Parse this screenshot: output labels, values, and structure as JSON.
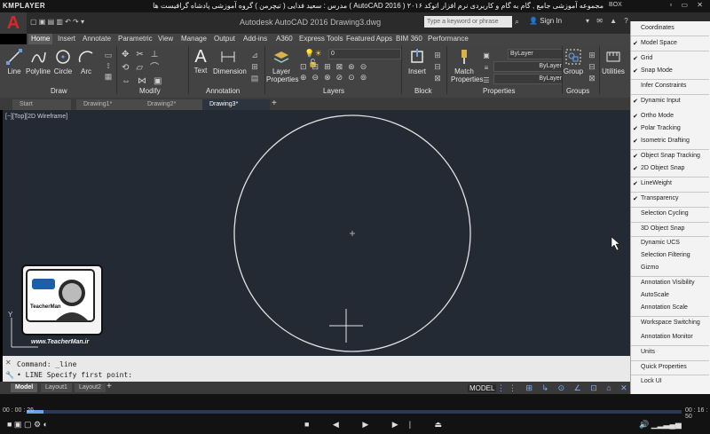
{
  "player": {
    "logo": "KMPLAYER",
    "title": "مجموعه آموزشی جامع , گام به گام و کاربردی نرم افزار اتوکد ۲۰۱۶ ( 2016 AutoCAD )  مدرس : سعید فدایی ( تیچرمن ) گروه آموزشی پادشاه گرافیست ها",
    "box_label": "BOX",
    "time_current": "00 : 00 : 26",
    "time_total": "00 : 16 : 50",
    "progress": 0.026
  },
  "acad": {
    "logo_letter": "A",
    "title": "Autodesk AutoCAD 2016   Drawing3.dwg",
    "search_placeholder": "Type a keyword or phrase",
    "sign_in": "Sign In",
    "tabs": [
      "Home",
      "Insert",
      "Annotate",
      "Parametric",
      "View",
      "Manage",
      "Output",
      "Add-ins",
      "A360",
      "Express Tools",
      "Featured Apps",
      "BIM 360",
      "Performance"
    ],
    "panels": {
      "draw": "Draw",
      "modify": "Modify",
      "annotation": "Annotation",
      "layers": "Layers",
      "block": "Block",
      "properties": "Properties",
      "groups": "Groups"
    },
    "tools": {
      "line": "Line",
      "polyline": "Polyline",
      "circle": "Circle",
      "arc": "Arc",
      "text": "Text",
      "dimension": "Dimension",
      "layer_properties_1": "Layer",
      "layer_properties_2": "Properties",
      "insert": "Insert",
      "match_properties_1": "Match",
      "match_properties_2": "Properties",
      "group": "Group",
      "utilities": "Utilities",
      "layer_value": "0",
      "bylayer_1": "ByLayer",
      "bylayer_2": "ByLayer",
      "bylayer_3": "ByLayer"
    },
    "file_tabs": [
      "Start",
      "Drawing1*",
      "Drawing2*",
      "Drawing3*"
    ],
    "view_label": "[−][Top][2D Wireframe]",
    "command_history": "Command: _line",
    "command_prompt": "• LINE Specify first point:",
    "layout_tabs": [
      "Model",
      "Layout1",
      "Layout2"
    ],
    "model_button": "MODEL",
    "watermark_site": "www.TeacherMan.ir",
    "watermark_label": "TeacherMan"
  },
  "menu": {
    "items": [
      {
        "label": "Coordinates",
        "checked": false
      },
      {
        "label": "Model Space",
        "checked": true
      },
      {
        "label": "Grid",
        "checked": true
      },
      {
        "label": "Snap Mode",
        "checked": true
      },
      {
        "label": "Infer Constraints",
        "checked": false
      },
      {
        "label": "Dynamic Input",
        "checked": true
      },
      {
        "label": "Ortho Mode",
        "checked": true
      },
      {
        "label": "Polar Tracking",
        "checked": true
      },
      {
        "label": "Isometric Drafting",
        "checked": true
      },
      {
        "label": "Object Snap Tracking",
        "checked": true
      },
      {
        "label": "2D Object Snap",
        "checked": true
      },
      {
        "label": "LineWeight",
        "checked": true
      },
      {
        "label": "Transparency",
        "checked": true
      },
      {
        "label": "Selection Cycling",
        "checked": false
      },
      {
        "label": "3D Object Snap",
        "checked": false
      },
      {
        "label": "Dynamic UCS",
        "checked": false
      },
      {
        "label": "Selection Filtering",
        "checked": false
      },
      {
        "label": "Gizmo",
        "checked": false
      },
      {
        "label": "Annotation Visibility",
        "checked": false
      },
      {
        "label": "AutoScale",
        "checked": false
      },
      {
        "label": "Annotation Scale",
        "checked": false
      },
      {
        "label": "Workspace Switching",
        "checked": false
      },
      {
        "label": "Annotation Monitor",
        "checked": false
      },
      {
        "label": "Units",
        "checked": false
      },
      {
        "label": "Quick Properties",
        "checked": false
      },
      {
        "label": "Lock UI",
        "checked": false
      }
    ]
  }
}
